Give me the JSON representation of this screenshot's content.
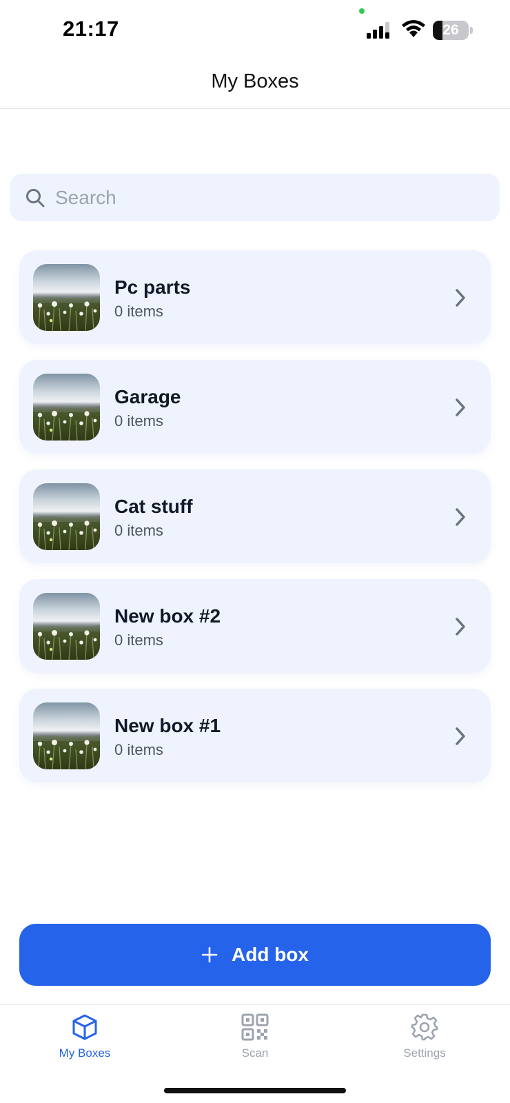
{
  "status_bar": {
    "time": "21:17",
    "battery_percent": "26",
    "battery_level": 0.26
  },
  "header": {
    "title": "My Boxes"
  },
  "search": {
    "placeholder": "Search",
    "value": ""
  },
  "boxes": [
    {
      "name": "Pc parts",
      "count": "0 items"
    },
    {
      "name": "Garage",
      "count": "0 items"
    },
    {
      "name": "Cat stuff",
      "count": "0 items"
    },
    {
      "name": "New box #2",
      "count": "0 items"
    },
    {
      "name": "New box #1",
      "count": "0 items"
    }
  ],
  "add_button": {
    "label": "Add box",
    "icon": "plus-icon"
  },
  "tab_bar": {
    "tabs": [
      {
        "label": "My Boxes",
        "icon": "cube-icon",
        "active": true
      },
      {
        "label": "Scan",
        "icon": "qr-code-icon",
        "active": false
      },
      {
        "label": "Settings",
        "icon": "gear-icon",
        "active": false
      }
    ]
  },
  "colors": {
    "accent": "#2563eb",
    "card_background": "#eff3fd",
    "inactive_tab": "#9ca3af"
  }
}
